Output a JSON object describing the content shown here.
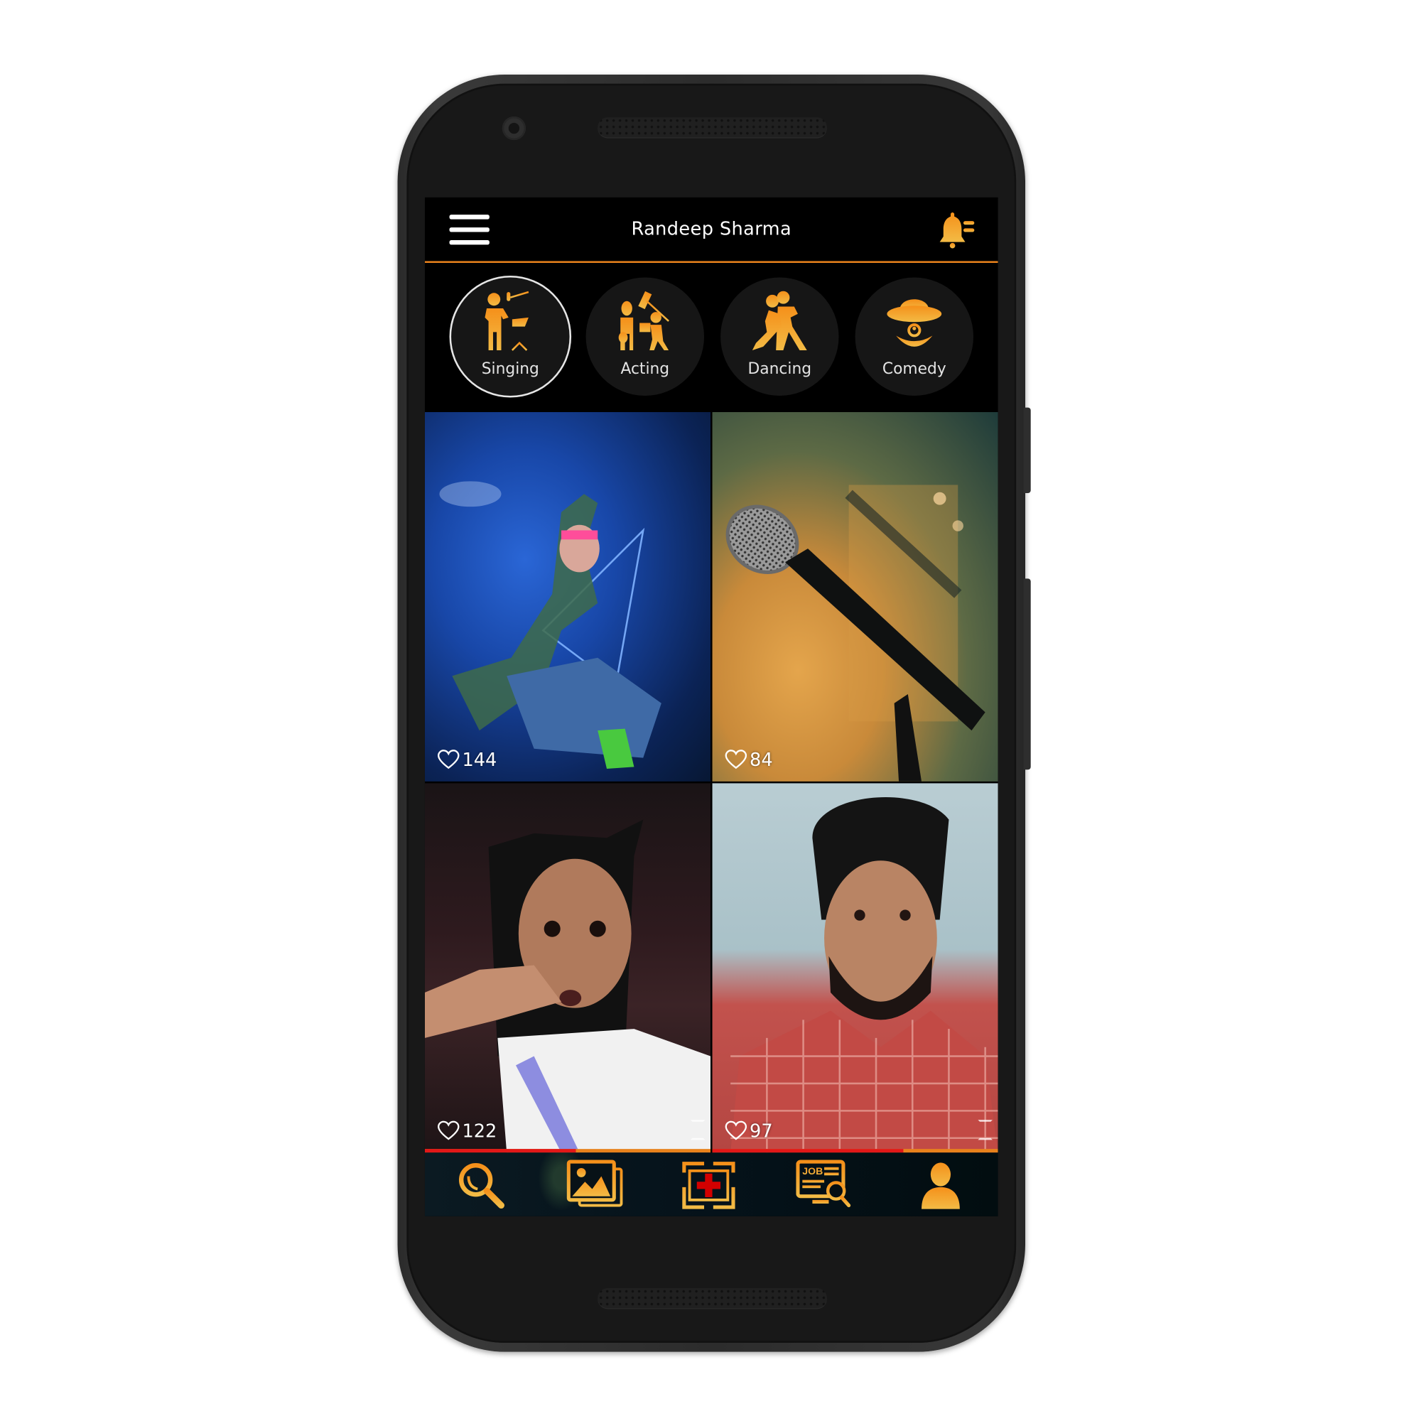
{
  "app": {
    "header": {
      "title": "Randeep Sharma",
      "menu_icon": "hamburger-menu-icon",
      "notification_icon": "bell-notification-icon"
    },
    "categories": [
      {
        "label": "Singing",
        "icon": "singer-microphone-icon",
        "selected": true
      },
      {
        "label": "Acting",
        "icon": "actor-clapperboard-icon",
        "selected": false
      },
      {
        "label": "Dancing",
        "icon": "dancing-couple-icon",
        "selected": false
      },
      {
        "label": "Comedy",
        "icon": "clown-face-icon",
        "selected": false
      }
    ],
    "feed": [
      {
        "likes": "144",
        "image": "dancer-photo",
        "progress": null
      },
      {
        "likes": "84",
        "image": "microphone-photo",
        "progress": null
      },
      {
        "likes": "122",
        "image": "woman-video",
        "progress": 0.53,
        "fullscreen_icon": "fullscreen-icon"
      },
      {
        "likes": "97",
        "image": "man-video",
        "progress": 0.67,
        "fullscreen_icon": "fullscreen-icon"
      }
    ],
    "bottom_nav": [
      {
        "name": "search",
        "icon": "search-icon"
      },
      {
        "name": "gallery",
        "icon": "gallery-images-icon"
      },
      {
        "name": "add-post",
        "icon": "add-media-plus-icon"
      },
      {
        "name": "jobs",
        "icon": "job-search-icon",
        "icon_text": "JOB"
      },
      {
        "name": "profile",
        "icon": "user-profile-icon"
      }
    ],
    "colors": {
      "accent": "#e8821c",
      "icon_gradient_top": "#f5901a",
      "icon_gradient_bottom": "#f3bb45",
      "progress_fill": "#e21818",
      "add_plus": "#d40000"
    }
  }
}
